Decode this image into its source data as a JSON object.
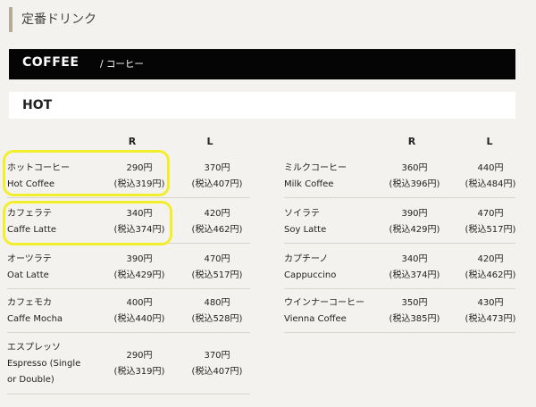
{
  "section_title": "定番ドリンク",
  "category": {
    "main": "COFFEE",
    "sub": "/ コーヒー"
  },
  "hot_label": "HOT",
  "col_headers": {
    "r": "R",
    "l": "L"
  },
  "left_items": [
    {
      "ja": "ホットコーヒー",
      "en": "Hot Coffee",
      "r_price": "290円",
      "r_tax": "(税込319円)",
      "l_price": "370円",
      "l_tax": "(税込407円)"
    },
    {
      "ja": "カフェラテ",
      "en": "Caffe Latte",
      "r_price": "340円",
      "r_tax": "(税込374円)",
      "l_price": "420円",
      "l_tax": "(税込462円)"
    },
    {
      "ja": "オーツラテ",
      "en": "Oat Latte",
      "r_price": "390円",
      "r_tax": "(税込429円)",
      "l_price": "470円",
      "l_tax": "(税込517円)"
    },
    {
      "ja": "カフェモカ",
      "en": "Caffe Mocha",
      "r_price": "400円",
      "r_tax": "(税込440円)",
      "l_price": "480円",
      "l_tax": "(税込528円)"
    },
    {
      "ja": "エスプレッソ",
      "en": "Espresso (Single or Double)",
      "r_price": "290円",
      "r_tax": "(税込319円)",
      "l_price": "370円",
      "l_tax": "(税込407円)"
    }
  ],
  "right_items": [
    {
      "ja": "ミルクコーヒー",
      "en": "Milk Coffee",
      "r_price": "360円",
      "r_tax": "(税込396円)",
      "l_price": "440円",
      "l_tax": "(税込484円)"
    },
    {
      "ja": "ソイラテ",
      "en": "Soy Latte",
      "r_price": "390円",
      "r_tax": "(税込429円)",
      "l_price": "470円",
      "l_tax": "(税込517円)"
    },
    {
      "ja": "カプチーノ",
      "en": "Cappuccino",
      "r_price": "340円",
      "r_tax": "(税込374円)",
      "l_price": "420円",
      "l_tax": "(税込462円)"
    },
    {
      "ja": "ウインナーコーヒー",
      "en": "Vienna Coffee",
      "r_price": "350円",
      "r_tax": "(税込385円)",
      "l_price": "430円",
      "l_tax": "(税込473円)"
    }
  ]
}
